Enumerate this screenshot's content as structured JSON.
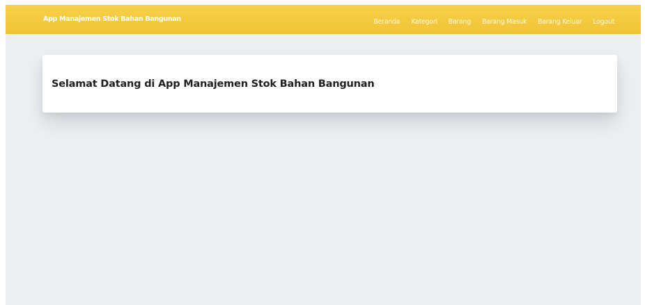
{
  "navbar": {
    "brand": "App Manajemen Stok Bahan Bangunan",
    "items": [
      {
        "label": "Beranda"
      },
      {
        "label": "Kategori"
      },
      {
        "label": "Barang"
      },
      {
        "label": "Barang Masuk"
      },
      {
        "label": "Barang Keluar"
      },
      {
        "label": "Logout"
      }
    ],
    "background_color": "#f3c93c",
    "text_color": "#ffffff"
  },
  "main": {
    "welcome_title": "Selamat Datang di App Manajemen Stok Bahan Bangunan",
    "background_color": "#edf0f3"
  }
}
